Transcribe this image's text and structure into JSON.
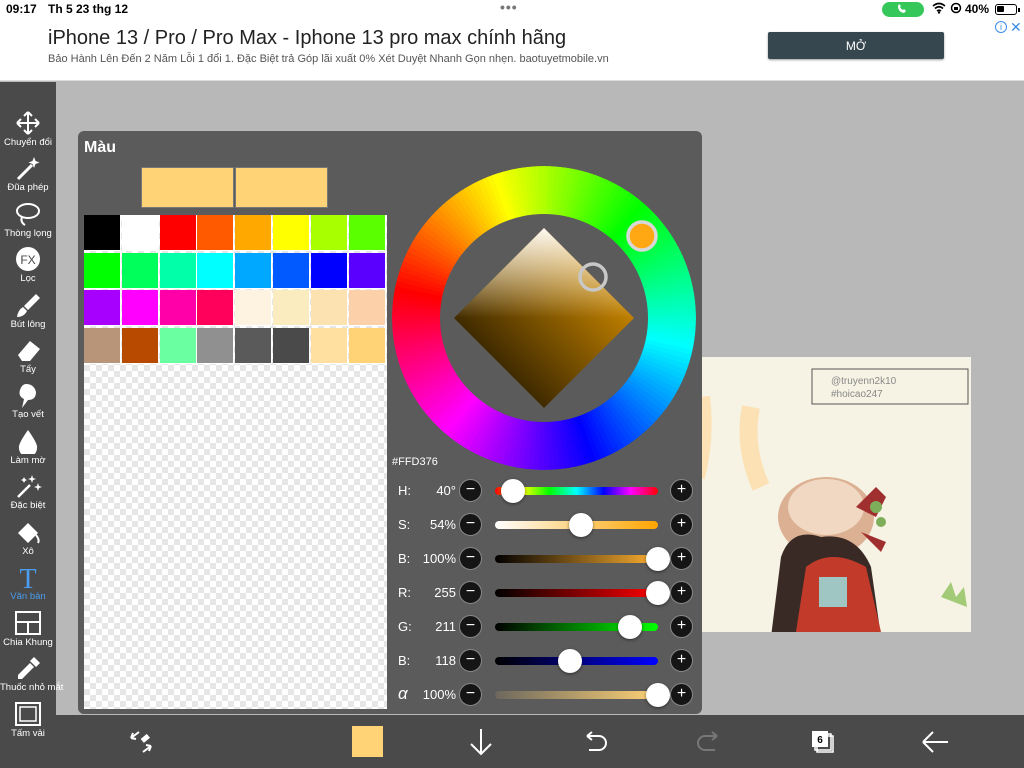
{
  "status_bar": {
    "time": "09:17",
    "date": "Th 5 23 thg 12",
    "battery": "40%"
  },
  "ad": {
    "title": "iPhone 13 / Pro / Pro Max - Iphone 13 pro max chính hãng",
    "description": "Bảo Hành Lên Đến 2 Năm Lỗi 1 đổi 1. Đặc Biệt trả Góp lãi xuất 0% Xét Duyệt Nhanh Gọn nhẹn. baotuyetmobile.vn",
    "button": "MỞ"
  },
  "toolbar": [
    {
      "label": "Chuyển đổi",
      "icon": "move-arrows-icon"
    },
    {
      "label": "Đũa phép",
      "icon": "magic-wand-icon"
    },
    {
      "label": "Thòng lọng",
      "icon": "lasso-icon"
    },
    {
      "label": "Lọc",
      "icon": "fx-filter-icon"
    },
    {
      "label": "Bút lông",
      "icon": "brush-icon"
    },
    {
      "label": "Tẩy",
      "icon": "eraser-icon"
    },
    {
      "label": "Tạo vết",
      "icon": "smudge-icon"
    },
    {
      "label": "Làm mờ",
      "icon": "blur-drop-icon"
    },
    {
      "label": "Đặc biệt",
      "icon": "special-effects-icon"
    },
    {
      "label": "Xô",
      "icon": "bucket-icon"
    },
    {
      "label": "Văn bản",
      "icon": "text-tool-icon",
      "active": true
    },
    {
      "label": "Chia Khung",
      "icon": "frame-divider-icon"
    },
    {
      "label": "Thuốc nhỏ mắt",
      "icon": "eyedropper-icon"
    },
    {
      "label": "Tấm vải",
      "icon": "canvas-icon"
    }
  ],
  "color_panel": {
    "title": "Màu",
    "current_color": "#FFD376",
    "previous_color": "#FFD376",
    "hex_label": "#FFD376",
    "palette": [
      "#000000",
      "#ffffff",
      "#ff0000",
      "#ff5a00",
      "#ffa800",
      "#ffff00",
      "#a8ff00",
      "#5aff00",
      "#00ff00",
      "#00ff5a",
      "#00ffa8",
      "#00ffff",
      "#00a8ff",
      "#005aff",
      "#0000ff",
      "#5a00ff",
      "#a800ff",
      "#ff00ff",
      "#ff00a8",
      "#ff005a",
      "#fdf3e0",
      "#fbecc0",
      "#fbe2b0",
      "#fcd0a8",
      "#b89478",
      "#b84a00",
      "#6affa0",
      "#909090",
      "#5a5a5a",
      "#4a4a4a",
      "#ffe0a0",
      "#ffd376"
    ],
    "sliders": [
      {
        "name": "H:",
        "value": "40°",
        "level": 0.11,
        "track": "hue"
      },
      {
        "name": "S:",
        "value": "54%",
        "level": 0.53,
        "track": "sat"
      },
      {
        "name": "B:",
        "value": "100%",
        "level": 1.0,
        "track": "bri"
      },
      {
        "name": "R:",
        "value": "255",
        "level": 1.0,
        "track": "red"
      },
      {
        "name": "G:",
        "value": "211",
        "level": 0.83,
        "track": "green"
      },
      {
        "name": "B:",
        "value": "118",
        "level": 0.46,
        "track": "blue"
      },
      {
        "name": "α",
        "value": "100%",
        "level": 1.0,
        "track": "alpha"
      }
    ]
  },
  "artwork": {
    "watermark_1": "@truyenn2k10",
    "watermark_2": "#hoicao247"
  },
  "bottom_bar": {
    "layers_count": "6"
  }
}
